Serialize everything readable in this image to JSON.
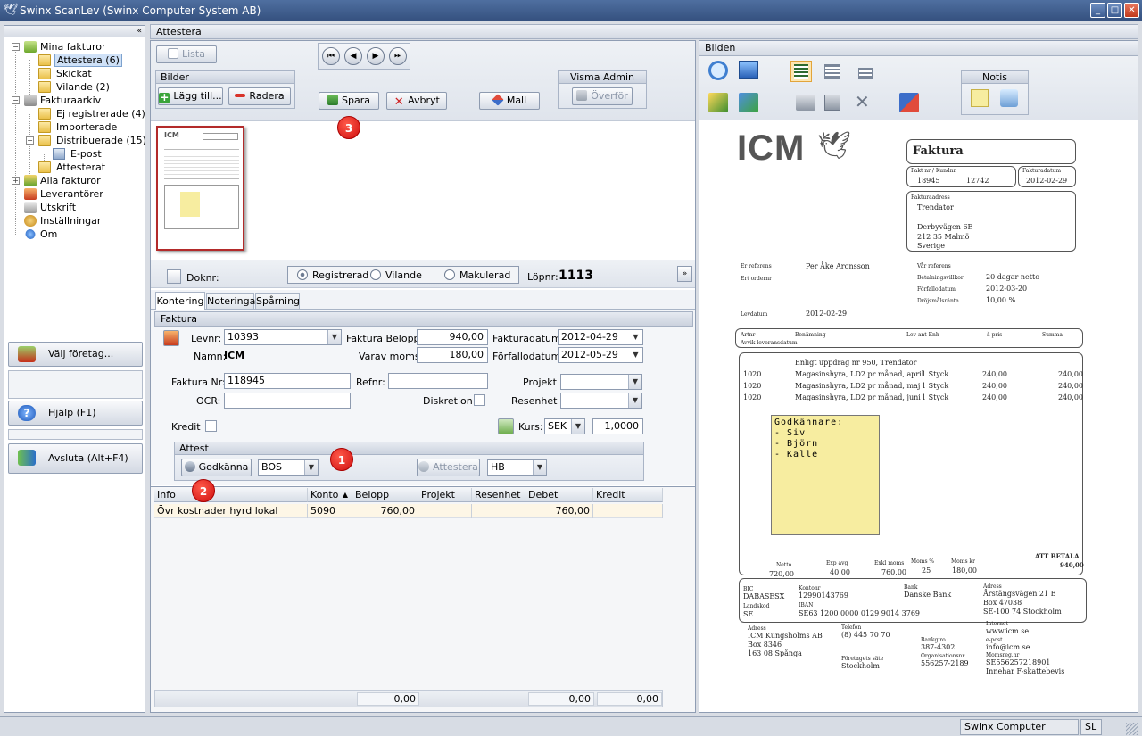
{
  "window": {
    "title": "Swinx ScanLev  (Swinx Computer System AB)"
  },
  "nav": {
    "collapse": "«",
    "tree": [
      {
        "label": "Mina fakturor"
      },
      {
        "label": "Attestera (6)"
      },
      {
        "label": "Skickat"
      },
      {
        "label": "Vilande (2)"
      },
      {
        "label": "Fakturaarkiv"
      },
      {
        "label": "Ej registrerade (4)"
      },
      {
        "label": "Importerade"
      },
      {
        "label": "Distribuerade (15)"
      },
      {
        "label": "E-post"
      },
      {
        "label": "Attesterat"
      },
      {
        "label": "Alla fakturor"
      },
      {
        "label": "Leverantörer"
      },
      {
        "label": "Utskrift"
      },
      {
        "label": "Inställningar"
      },
      {
        "label": "Om"
      }
    ],
    "buttons": {
      "company": "Välj företag...",
      "help": "Hjälp (F1)",
      "exit": "Avsluta (Alt+F4)"
    }
  },
  "panel": {
    "title": "Attestera"
  },
  "toolbar": {
    "list": "Lista",
    "bilder_title": "Bilder",
    "add": "Lägg till...",
    "delete": "Radera",
    "save": "Spara",
    "cancel": "Avbryt",
    "template": "Mall",
    "visma_title": "Visma Admin",
    "transfer": "Överför"
  },
  "thumb": {
    "logo": "ICM"
  },
  "doc": {
    "doknr_label": "Doknr:",
    "status_options": [
      "Registrerad",
      "Vilande",
      "Makulerad"
    ],
    "lopnr_label": "Löpnr:",
    "lopnr": "1113"
  },
  "tabs": [
    "Kontering",
    "Noteringar",
    "Spårning"
  ],
  "invoice_form": {
    "section": "Faktura",
    "levnr_label": "Levnr:",
    "levnr": "10393",
    "namn_label": "Namn:",
    "namn": "ICM",
    "belopp_label": "Faktura Belopp:",
    "belopp": "940,00",
    "moms_label": "Varav moms:",
    "moms": "180,00",
    "fdatum_label": "Fakturadatum:",
    "fdatum": "2012-04-29",
    "forf_label": "Förfallodatum:",
    "forf": "2012-05-29",
    "fnr_label": "Faktura Nr:",
    "fnr": "118945",
    "refnr_label": "Refnr:",
    "refnr": "",
    "projekt_label": "Projekt",
    "projekt": "",
    "ocr_label": "OCR:",
    "ocr": "",
    "diskretion_label": "Diskretion:",
    "resenhet_label": "Resenhet",
    "resenhet": "",
    "kredit_label": "Kredit",
    "kurs_label": "Kurs:",
    "valuta": "SEK",
    "kurs": "1,0000"
  },
  "attest": {
    "title": "Attest",
    "approve": "Godkänna",
    "approver": "BOS",
    "attest_btn": "Attestera",
    "attester": "HB"
  },
  "grid": {
    "columns": [
      "Info",
      "Konto",
      "Belopp",
      "Projekt",
      "Resenhet",
      "Debet",
      "Kredit"
    ],
    "rows": [
      [
        "Övr kostnader hyrd lokal",
        "5090",
        "760,00",
        "",
        "",
        "760,00",
        ""
      ]
    ],
    "footer": [
      "0,00",
      "0,00",
      "0,00"
    ]
  },
  "bilden": {
    "title": "Bilden",
    "notis_title": "Notis"
  },
  "invoice_image": {
    "logo": "ICM",
    "heading": "Faktura",
    "faktnr_label": "Fakt nr / Kundnr",
    "faktnr": "18945",
    "kundnr": "12742",
    "fdatum_label": "Fakturadatum",
    "fdatum": "2012-02-29",
    "addr_label": "Fakturaadress",
    "addr": [
      "Trendator",
      "",
      "Derbyvägen 6E",
      "212 35  Malmö",
      "Sverige"
    ],
    "left_labels": [
      "Er referens",
      "Ert ordernr",
      "",
      "",
      "Levdatum"
    ],
    "left_values": [
      "Per Åke Aronsson",
      "",
      "",
      "",
      "2012-02-29"
    ],
    "right_labels": [
      "Vår referens",
      "Betalningsvillkor",
      "Förfallodatum",
      "Dröjsmålsränta"
    ],
    "right_values": [
      "",
      "20 dagar netto",
      "2012-03-20",
      "10,00 %"
    ],
    "col_headers": [
      "Artnr",
      "Benämning",
      "Lev ant Enh",
      "à-pris",
      "Summa"
    ],
    "col_sub": "Avvik leveransdatum",
    "lines": [
      [
        "",
        "Enligt uppdrag nr 950, Trendator",
        "",
        "",
        ""
      ],
      [
        "1020",
        "Magasinshyra, LD2 pr månad, april",
        "1 Styck",
        "240,00",
        "240,00"
      ],
      [
        "1020",
        "Magasinshyra, LD2 pr månad, maj",
        "1 Styck",
        "240,00",
        "240,00"
      ],
      [
        "1020",
        "Magasinshyra, LD2 pr månad, juni",
        "1 Styck",
        "240,00",
        "240,00"
      ]
    ],
    "note_title": "Godkännare:",
    "note_lines": [
      "- Siv",
      "- Björn",
      "- Kalle"
    ],
    "totals_labels": [
      "Netto",
      "Exp avg",
      "Exkl moms",
      "Moms %",
      "Moms kr"
    ],
    "totals_values": [
      "720,00",
      "40,00",
      "760,00",
      "25",
      "180,00"
    ],
    "att_betala_label": "ATT BETALA",
    "att_betala": "940,00",
    "bank": [
      [
        "BIC",
        "DABASESX",
        "Kontonr",
        "12990143769",
        "Bank",
        "Danske Bank",
        "Adress",
        "Årstängsvägen 21 B"
      ],
      [
        "Landskod",
        "SE",
        "IBAN",
        "SE63 1200 0000 0129 9014 3769",
        "",
        "",
        "",
        "Box 47038"
      ],
      [
        "",
        "",
        "",
        "",
        "",
        "",
        "",
        "SE-100 74 Stockholm"
      ]
    ],
    "footer": {
      "adress_label": "Adress",
      "adress": [
        "ICM Kungsholms AB",
        "Box 8346",
        "163 08  Spånga"
      ],
      "telefon_label": "Telefon",
      "telefon": "(8) 445 70 70",
      "sate_label": "Företagets säte",
      "sate": "Stockholm",
      "bankgiro_label": "Bankgiro",
      "bankgiro": "387-4302",
      "orgnr_label": "Organisationsnr",
      "orgnr": "556257-2189",
      "internet_label": "Internet",
      "internet": "www.icm.se",
      "epost_label": "e-post",
      "epost": "info@icm.se",
      "momsreg_label": "Momsreg.nr",
      "momsreg": "SE556257218901",
      "fskatt": "Innehar F-skattebevis"
    }
  },
  "badges": [
    "1",
    "2",
    "3"
  ],
  "status": {
    "company": "Swinx Computer System AB",
    "user": "SL"
  },
  "colors": {
    "titlebar": "#3f5e8f",
    "selection": "#cfe1f7",
    "badge": "#d81212",
    "note": "#f7eda0"
  }
}
